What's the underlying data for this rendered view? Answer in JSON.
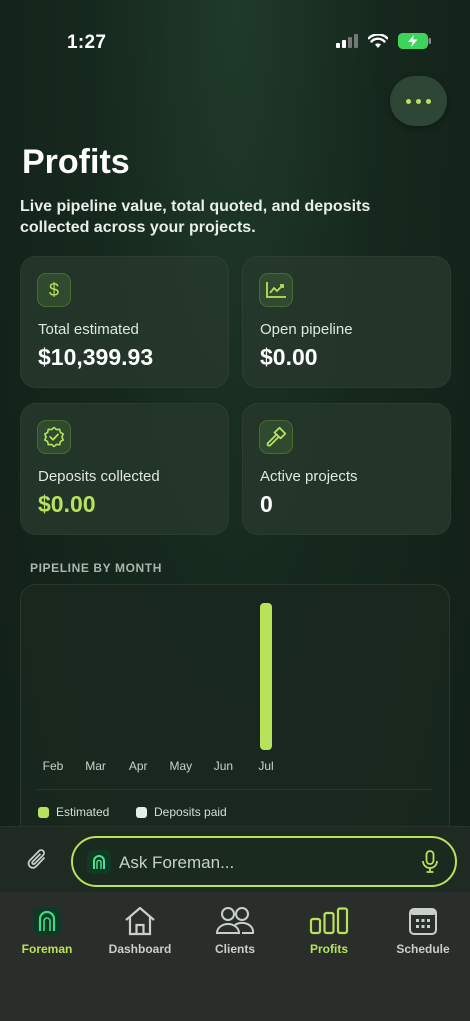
{
  "status_bar": {
    "time": "1:27"
  },
  "header": {
    "title": "Profits",
    "subtitle": "Live pipeline value, total quoted, and deposits collected across your projects.",
    "more_icon": "more-dots-icon"
  },
  "stats": [
    {
      "label": "Total estimated",
      "value": "$10,399.93",
      "icon": "dollar-icon"
    },
    {
      "label": "Open pipeline",
      "value": "$0.00",
      "icon": "trend-chart-icon"
    },
    {
      "label": "Deposits collected",
      "value": "$0.00",
      "icon": "verified-badge-icon"
    },
    {
      "label": "Active projects",
      "value": "0",
      "icon": "hammer-icon"
    }
  ],
  "chart_section": {
    "title": "PIPELINE BY MONTH"
  },
  "chart_data": {
    "type": "bar",
    "categories": [
      "Feb",
      "Mar",
      "Apr",
      "May",
      "Jun",
      "Jul"
    ],
    "series": [
      {
        "name": "Estimated",
        "values": [
          0,
          0,
          0,
          0,
          0,
          10399.93
        ]
      },
      {
        "name": "Deposits paid",
        "values": [
          0,
          0,
          0,
          0,
          0,
          0
        ]
      }
    ],
    "legend": [
      "Estimated",
      "Deposits paid"
    ],
    "colors": {
      "Estimated": "#b7e25a",
      "Deposits paid": "#e6ece8"
    },
    "grid": false,
    "legend_position": "bottom-left"
  },
  "ask_bar": {
    "placeholder": "Ask Foreman..."
  },
  "tabs": [
    {
      "label": "Foreman",
      "icon": "foreman-logo-icon",
      "active": false
    },
    {
      "label": "Dashboard",
      "icon": "home-icon",
      "active": false
    },
    {
      "label": "Clients",
      "icon": "users-icon",
      "active": false
    },
    {
      "label": "Profits",
      "icon": "bar-chart-icon",
      "active": true
    },
    {
      "label": "Schedule",
      "icon": "calendar-icon",
      "active": false
    }
  ],
  "colors": {
    "accent": "#b7e25a",
    "background": "#16281d",
    "card": "#283a2e"
  }
}
